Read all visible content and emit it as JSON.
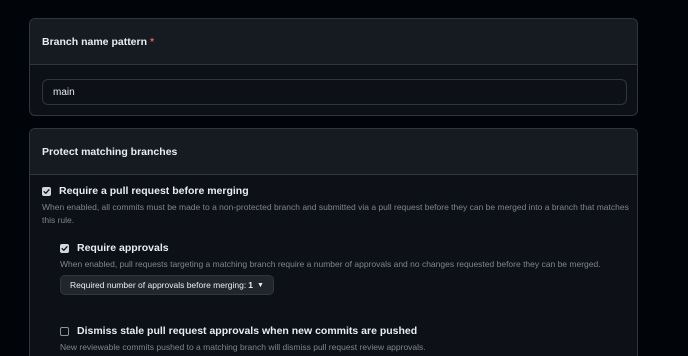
{
  "branch_pattern": {
    "label": "Branch name pattern",
    "required_marker": "*",
    "value": "main"
  },
  "protect": {
    "header": "Protect matching branches",
    "options": [
      {
        "label": "Require a pull request before merging",
        "checked": true,
        "description": "When enabled, all commits must be made to a non-protected branch and submitted via a pull request before they can be merged into a branch that matches this rule."
      },
      {
        "label": "Require approvals",
        "checked": true,
        "description": "When enabled, pull requests targeting a matching branch require a number of approvals and no changes requested before they can be merged.",
        "select": {
          "label": "Required number of approvals before merging:",
          "value": "1"
        }
      },
      {
        "label": "Dismiss stale pull request approvals when new commits are pushed",
        "checked": false,
        "description": "New reviewable commits pushed to a matching branch will dismiss pull request review approvals."
      }
    ]
  },
  "icons": {
    "checkbox_checked": "check-icon",
    "select_caret": "caret-down-icon"
  }
}
